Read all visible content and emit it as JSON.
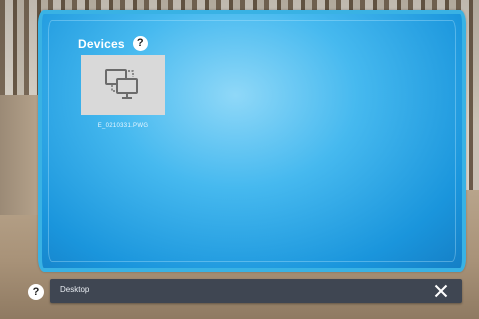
{
  "panel": {
    "title": "Devices",
    "help_glyph": "?",
    "accent_color": "#39b2e4",
    "devices": [
      {
        "label": "E_0210331.PWG",
        "icon": "connected-screens-icon"
      }
    ]
  },
  "taskbar": {
    "help_glyph": "?",
    "label": "Desktop",
    "close_icon": "close-icon"
  }
}
